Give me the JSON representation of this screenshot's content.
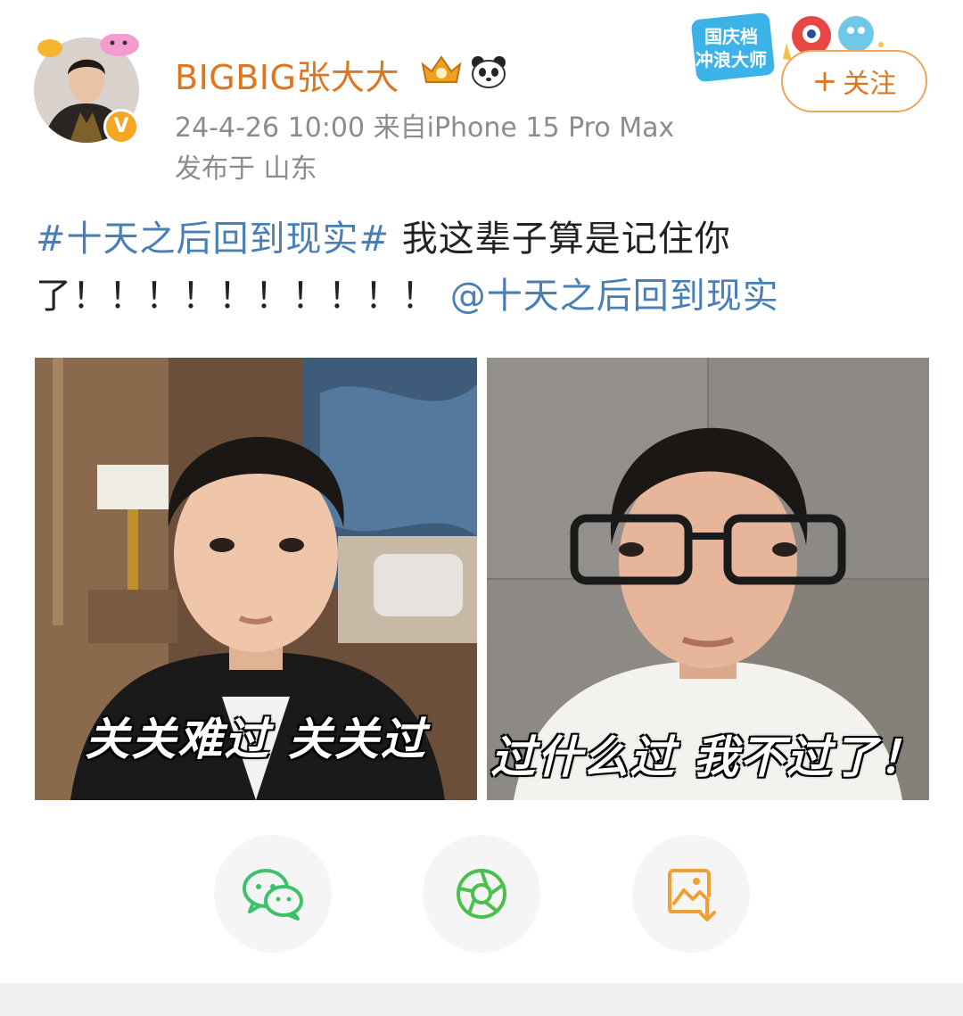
{
  "user": {
    "name": "BIGBIG张大大",
    "verified_badge": "V",
    "avatar_icon": "avatar-photo"
  },
  "meta": {
    "time_source": "24-4-26 10:00  来自iPhone 15 Pro Max",
    "location": "发布于 山东"
  },
  "event_badge": {
    "line1": "国庆档",
    "line2": "冲浪大师"
  },
  "follow_button": {
    "plus": "+",
    "label": "关注"
  },
  "post": {
    "topic": "#十天之后回到现实#",
    "text": " 我这辈子算是记住你了！！！！！！！！！！ ",
    "mention": "@十天之后回到现实"
  },
  "images": [
    {
      "caption": "关关难过  关关过",
      "icon": "selfie-photo"
    },
    {
      "caption": "过什么过  我不过了！",
      "icon": "selfie-photo-glasses"
    }
  ],
  "share": [
    {
      "icon": "wechat-icon",
      "color": "#3cc26a"
    },
    {
      "icon": "moments-icon",
      "color": "#4cbf4c"
    },
    {
      "icon": "save-image-icon",
      "color": "#f0a030"
    }
  ],
  "colors": {
    "accent_orange": "#e0751f",
    "link_blue": "#4a7fb5",
    "meta_gray": "#8c8c8c"
  }
}
